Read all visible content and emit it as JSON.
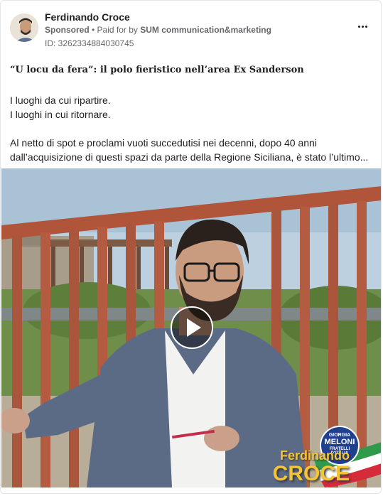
{
  "post": {
    "page_name": "Ferdinando Croce",
    "sponsored_label": "Sponsored",
    "separator": " • ",
    "paid_for_prefix": "Paid for by ",
    "paid_for_by": "SUM communication&marketing",
    "ad_id": "ID: 3262334884030745",
    "headline": "“U locu da fera”: il polo fieristico nell’area Ex Sanderson",
    "body_lines": [
      "I luoghi da cui ripartire.",
      "I luoghi in cui ritornare.",
      "",
      "Al netto di spot e proclami vuoti succedutisi nei decenni, dopo 40 anni",
      "dall’acquisizione di questi spazi da parte della Regione Siciliana, è stato l’ultimo..."
    ]
  },
  "video": {
    "caption_first_name": "Ferdinando",
    "caption_last_name": "CROCE",
    "party_logo": {
      "line1": "GIORGIA",
      "line2": "MELONI",
      "line3": "FRATELLI D'ITALIA"
    },
    "play_icon": "play-icon"
  },
  "icons": {
    "more": "more-horizontal-icon"
  },
  "colors": {
    "caption_yellow": "#f3c536",
    "party_blue": "#1f3f8f",
    "text_secondary": "#65676b"
  }
}
